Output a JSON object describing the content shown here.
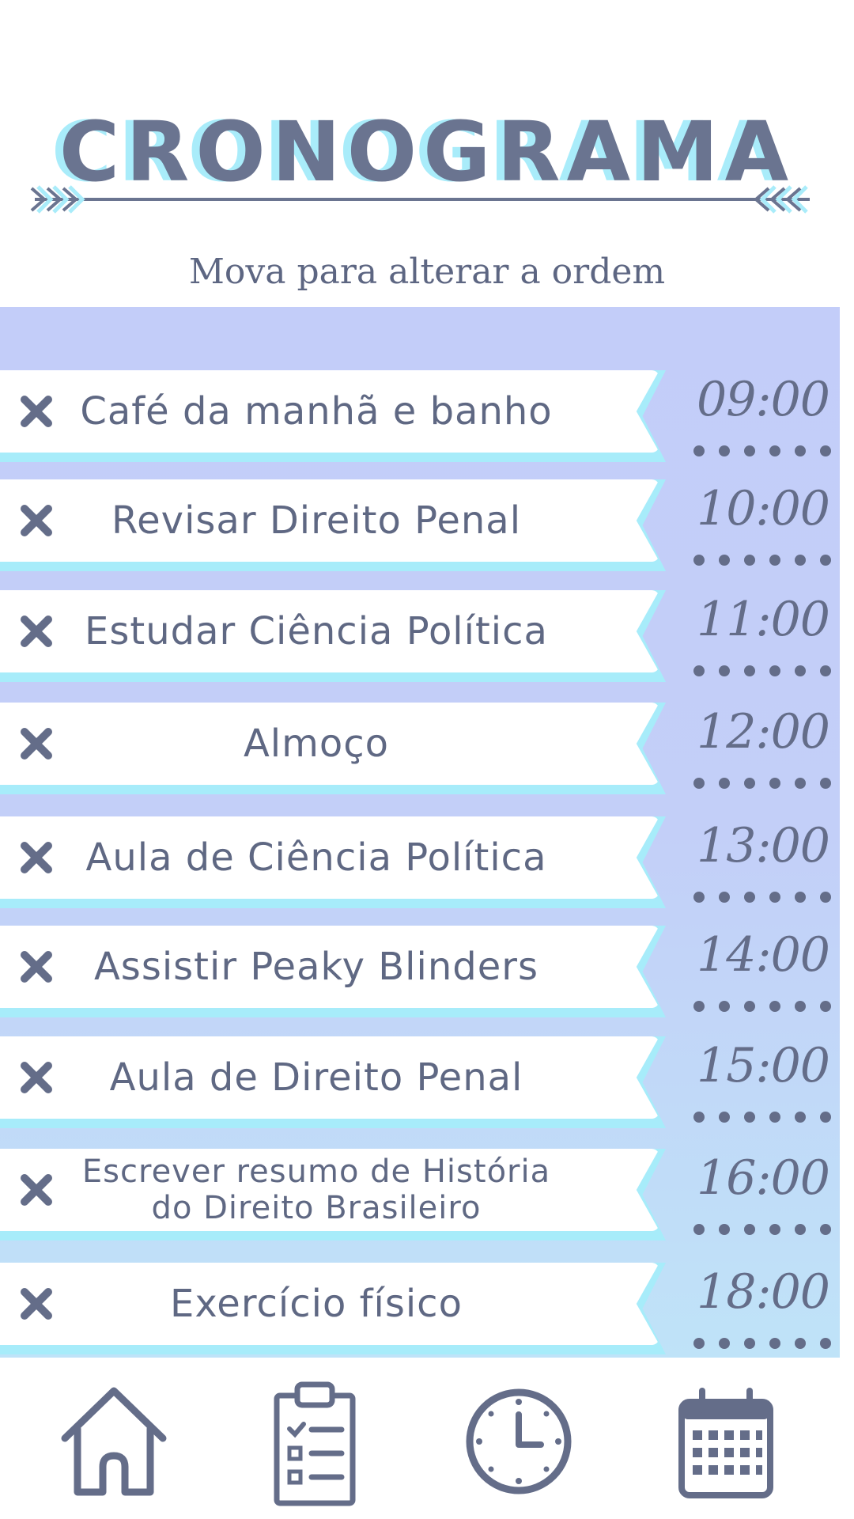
{
  "header": {
    "title": "CRONOGRAMA",
    "subtitle": "Mova para alterar a ordem"
  },
  "schedule": [
    {
      "task": "Café da manhã e banho",
      "time": "09:00"
    },
    {
      "task": "Revisar Direito Penal",
      "time": "10:00"
    },
    {
      "task": "Estudar Ciência Política",
      "time": "11:00"
    },
    {
      "task": "Almoço",
      "time": "12:00"
    },
    {
      "task": "Aula de Ciência Política",
      "time": "13:00"
    },
    {
      "task": "Assistir Peaky Blinders",
      "time": "14:00"
    },
    {
      "task": "Aula de Direito Penal",
      "time": "15:00"
    },
    {
      "task": "Escrever resumo de História do Direito Brasileiro",
      "time": "16:00"
    },
    {
      "task": "Exercício físico",
      "time": "18:00"
    }
  ],
  "nav": {
    "items": [
      {
        "icon": "home-icon"
      },
      {
        "icon": "clipboard-checklist-icon"
      },
      {
        "icon": "clock-icon"
      },
      {
        "icon": "calendar-icon"
      }
    ]
  },
  "colors": {
    "title": "#6a7490",
    "title_shadow": "#a9ecfa",
    "list_background": "#c3cdf9",
    "band": "#ffffff",
    "band_shadow": "#a7ecfa",
    "text": "#5f6883"
  }
}
